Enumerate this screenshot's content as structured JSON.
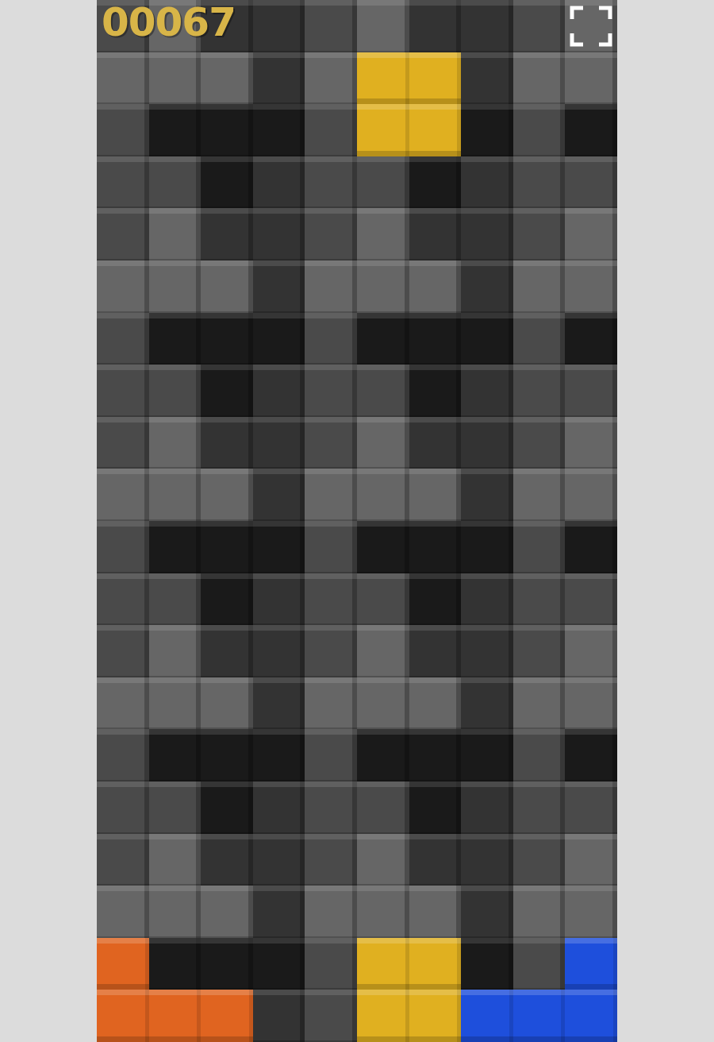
{
  "score": "00067",
  "pieces": [
    {
      "color": "#e0b020",
      "cells": [
        [
          1,
          5
        ],
        [
          1,
          6
        ],
        [
          2,
          5
        ],
        [
          2,
          6
        ]
      ]
    },
    {
      "color": "#e06420",
      "cells": [
        [
          18,
          0
        ],
        [
          19,
          0
        ],
        [
          19,
          1
        ],
        [
          19,
          2
        ]
      ]
    },
    {
      "color": "#e0b020",
      "cells": [
        [
          18,
          5
        ],
        [
          18,
          6
        ],
        [
          19,
          5
        ],
        [
          19,
          6
        ]
      ]
    },
    {
      "color": "#1e4fdc",
      "cells": [
        [
          18,
          9
        ],
        [
          19,
          7
        ],
        [
          19,
          8
        ],
        [
          19,
          9
        ]
      ]
    }
  ]
}
